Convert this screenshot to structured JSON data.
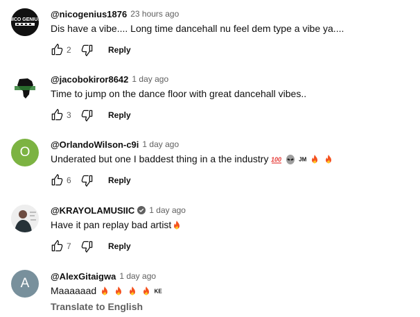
{
  "comments": [
    {
      "author": "@nicogenius1876",
      "time": "23 hours ago",
      "text": "Dis have a vibe.... Long time dancehall nu feel dem type a vibe ya....",
      "likes": "2",
      "reply_label": "Reply",
      "avatar_bg": "#111111"
    },
    {
      "author": "@jacobokiror8642",
      "time": "1 day ago",
      "text": "Time to jump on the dance floor with great dancehall vibes..",
      "likes": "3",
      "reply_label": "Reply",
      "avatar_bg": "#ffffff"
    },
    {
      "author": "@OrlandoWilson-c9i",
      "time": "1 day ago",
      "text": "Underated but one I baddest thing in a the industry",
      "text_suffix": "JM",
      "likes": "6",
      "reply_label": "Reply",
      "avatar_letter": "O",
      "avatar_bg": "#7cb342"
    },
    {
      "author": "@KRAYOLAMUSIIC",
      "time": "1 day ago",
      "text": "Have it pan replay bad artist",
      "likes": "7",
      "reply_label": "Reply",
      "avatar_bg": "#eeeeee"
    },
    {
      "author": "@AlexGitaigwa",
      "time": "1 day ago",
      "text": "Maaaaaad",
      "text_suffix": "KE",
      "translate_label": "Translate to English",
      "avatar_letter": "A",
      "avatar_bg": "#78909c"
    }
  ],
  "icons": {
    "like": "thumb-up-icon",
    "dislike": "thumb-down-icon",
    "verified": "verified-check-icon",
    "fire": "fire-emoji",
    "hundred": "hundred-points-emoji",
    "alien": "alien-emoji"
  }
}
